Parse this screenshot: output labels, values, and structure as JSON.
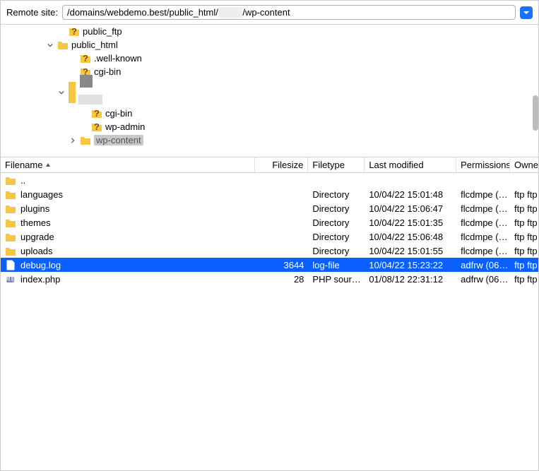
{
  "topbar": {
    "label": "Remote site:",
    "path_prefix": "/domains/webdemo.best/public_html/",
    "path_suffix": "/wp-content"
  },
  "tree": {
    "n0": "public_ftp",
    "n1": "public_html",
    "n2": ".well-known",
    "n3": "cgi-bin",
    "n4": "cgi-bin",
    "n5": "wp-admin",
    "n6": "wp-content"
  },
  "headers": {
    "name": "Filename",
    "size": "Filesize",
    "type": "Filetype",
    "mod": "Last modified",
    "perm": "Permissions",
    "owner": "Owner"
  },
  "rows": [
    {
      "name": "..",
      "size": "",
      "type": "",
      "mod": "",
      "perm": "",
      "owner": "",
      "icon": "folder"
    },
    {
      "name": "languages",
      "size": "",
      "type": "Directory",
      "mod": "10/04/22 15:01:48",
      "perm": "flcdmpe (…",
      "owner": "ftp ftp",
      "icon": "folder"
    },
    {
      "name": "plugins",
      "size": "",
      "type": "Directory",
      "mod": "10/04/22 15:06:47",
      "perm": "flcdmpe (…",
      "owner": "ftp ftp",
      "icon": "folder"
    },
    {
      "name": "themes",
      "size": "",
      "type": "Directory",
      "mod": "10/04/22 15:01:35",
      "perm": "flcdmpe (…",
      "owner": "ftp ftp",
      "icon": "folder"
    },
    {
      "name": "upgrade",
      "size": "",
      "type": "Directory",
      "mod": "10/04/22 15:06:48",
      "perm": "flcdmpe (…",
      "owner": "ftp ftp",
      "icon": "folder"
    },
    {
      "name": "uploads",
      "size": "",
      "type": "Directory",
      "mod": "10/04/22 15:01:55",
      "perm": "flcdmpe (…",
      "owner": "ftp ftp",
      "icon": "folder"
    },
    {
      "name": "debug.log",
      "size": "3644",
      "type": "log-file",
      "mod": "10/04/22 15:23:22",
      "perm": "adfrw (06…",
      "owner": "ftp ftp",
      "icon": "file",
      "selected": true
    },
    {
      "name": "index.php",
      "size": "28",
      "type": "PHP sour…",
      "mod": "01/08/12 22:31:12",
      "perm": "adfrw (06…",
      "owner": "ftp ftp",
      "icon": "php"
    }
  ]
}
